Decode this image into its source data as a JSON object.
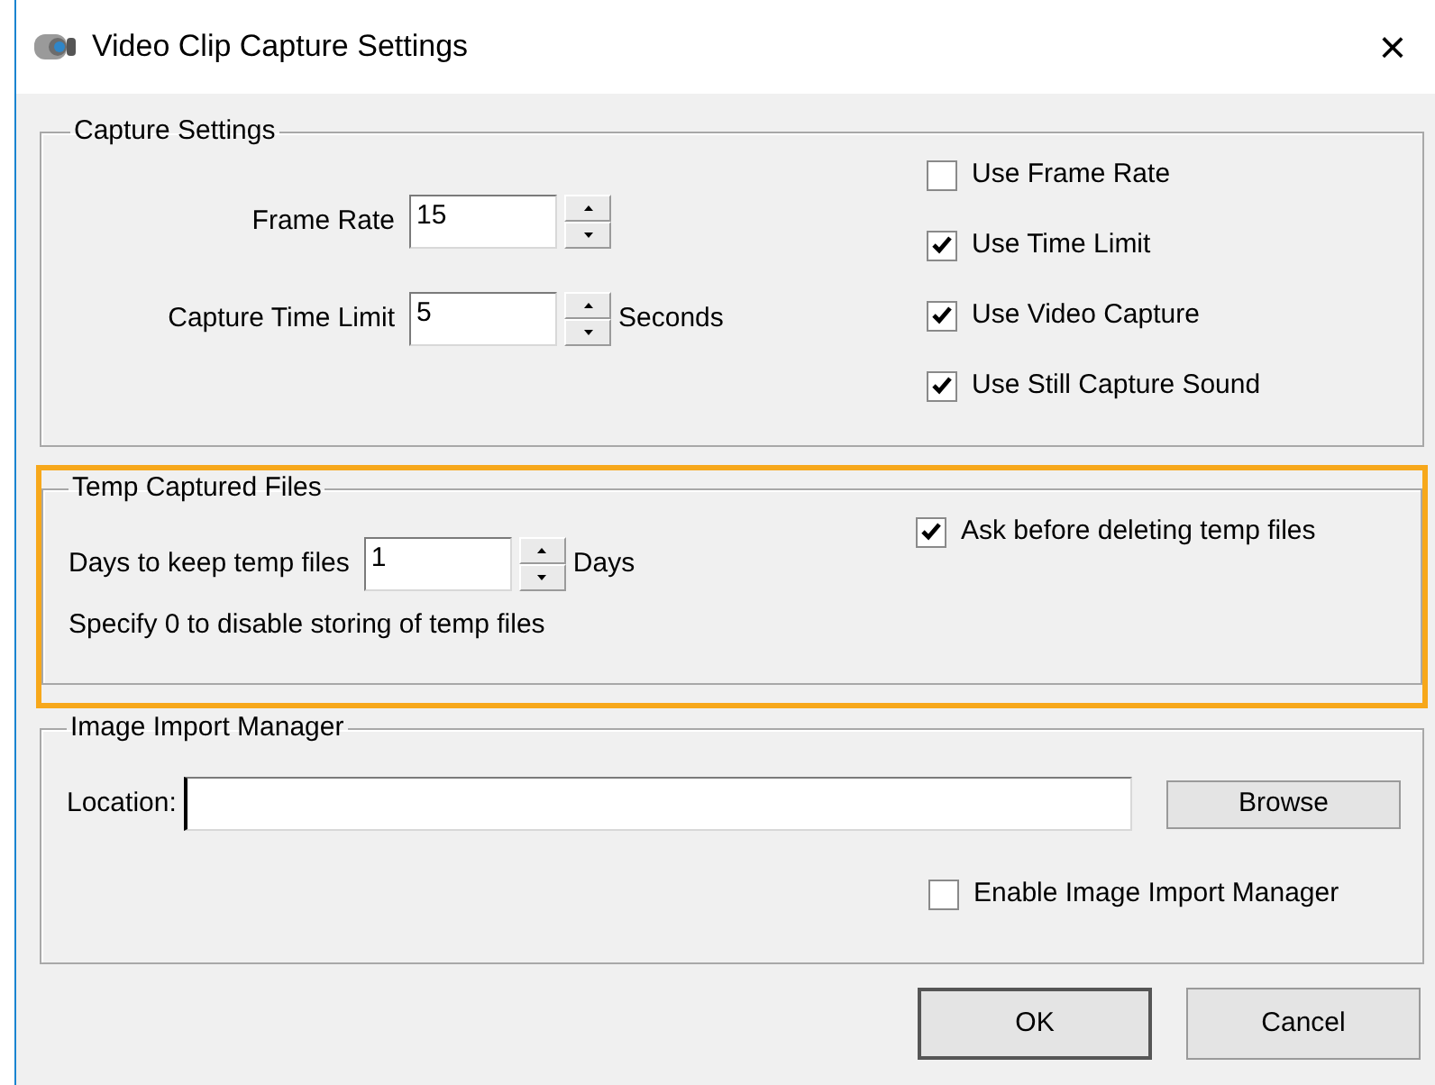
{
  "window": {
    "title": "Video Clip Capture Settings",
    "close": "×"
  },
  "capture_settings": {
    "title": "Capture Settings",
    "fields": [
      {
        "label": "Frame Rate",
        "value": "15"
      },
      {
        "label": "Capture Time Limit",
        "value": "5",
        "unit": "Seconds"
      }
    ],
    "checkboxes": [
      {
        "label": "Use Frame Rate",
        "checked": false
      },
      {
        "label": "Use Time Limit",
        "checked": true
      },
      {
        "label": "Use Video Capture",
        "checked": true
      },
      {
        "label": "Use Still Capture Sound",
        "checked": true
      }
    ]
  },
  "temp_files": {
    "title": "Temp Captured Files",
    "highlighted": true,
    "field": {
      "label": "Days to keep temp files",
      "value": "1",
      "unit": "Days"
    },
    "note": "Specify 0 to disable storing of temp files",
    "checkboxes": [
      {
        "label": "Ask before deleting temp files",
        "checked": true
      }
    ]
  },
  "image_import": {
    "title": "Image Import Manager",
    "location_label": "Location:",
    "browse_button": "Browse",
    "checkboxes": [
      {
        "label": "Enable Image Import Manager",
        "checked": false
      }
    ]
  },
  "buttons": [
    {
      "label": "OK",
      "default": true
    },
    {
      "label": "Cancel",
      "default": false
    }
  ]
}
